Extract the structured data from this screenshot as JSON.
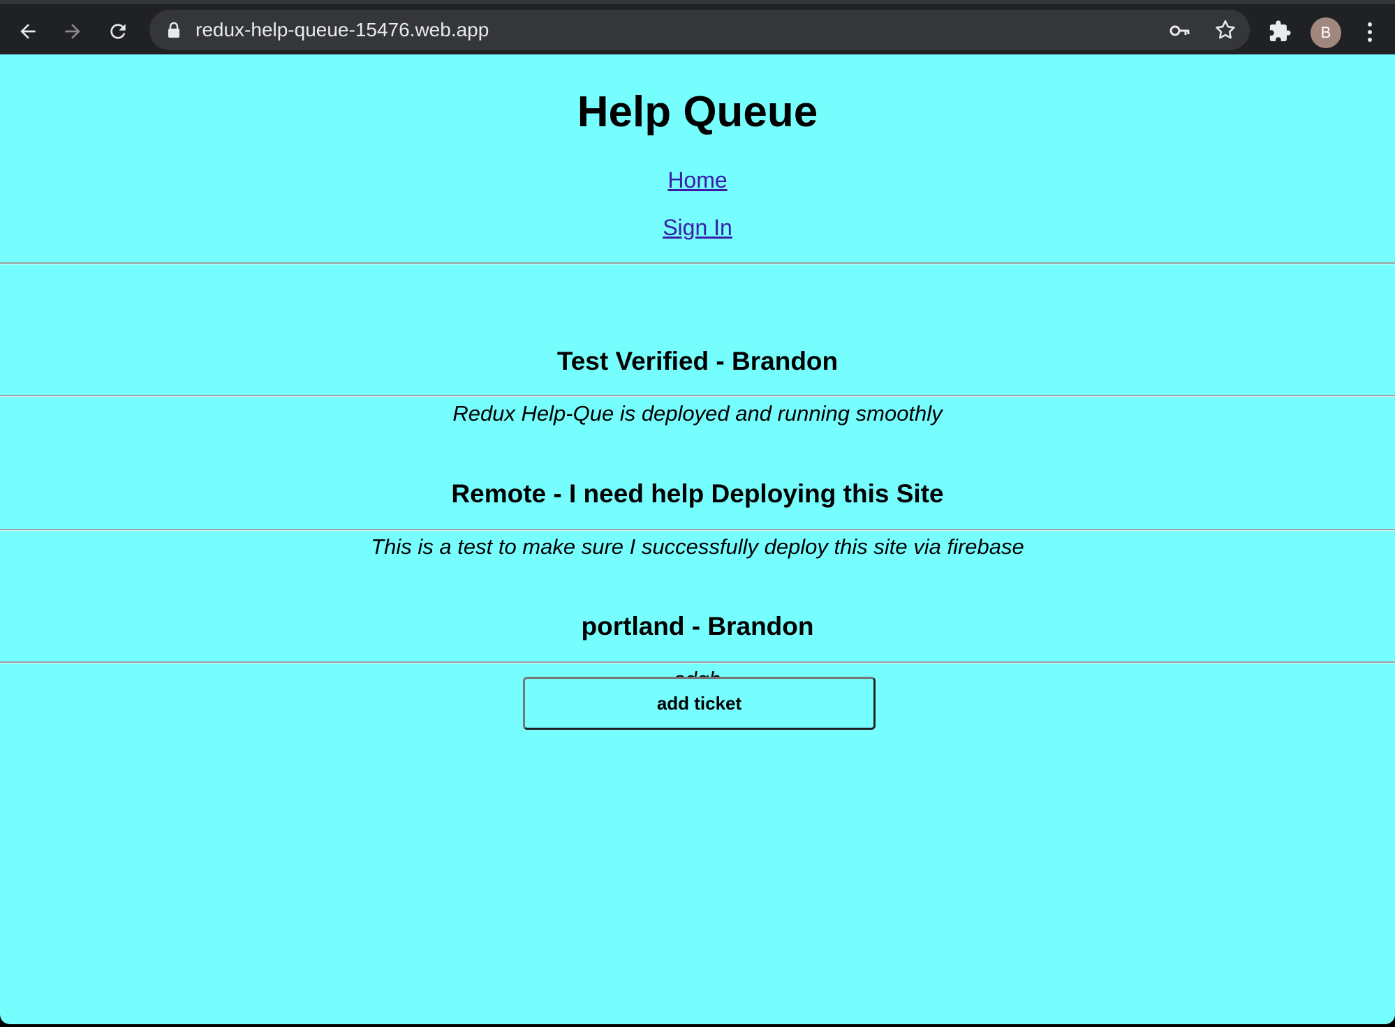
{
  "browser": {
    "url": "redux-help-queue-15476.web.app",
    "avatar_letter": "B"
  },
  "app": {
    "title": "Help Queue",
    "nav": {
      "home": "Home",
      "sign_in": "Sign In"
    }
  },
  "tickets": [
    {
      "title": "Test Verified - Brandon",
      "issue": "Redux Help-Que is deployed and running smoothly"
    },
    {
      "title": "Remote - I need help Deploying this Site",
      "issue": "This is a test to make sure I successfully deploy this site via firebase"
    },
    {
      "title": "portland - Brandon",
      "issue": "sdgh"
    }
  ],
  "actions": {
    "add_ticket": "add ticket"
  },
  "colors": {
    "page_background": "#76fdfd",
    "link": "#3a1ea8",
    "browser_chrome": "#202124"
  }
}
